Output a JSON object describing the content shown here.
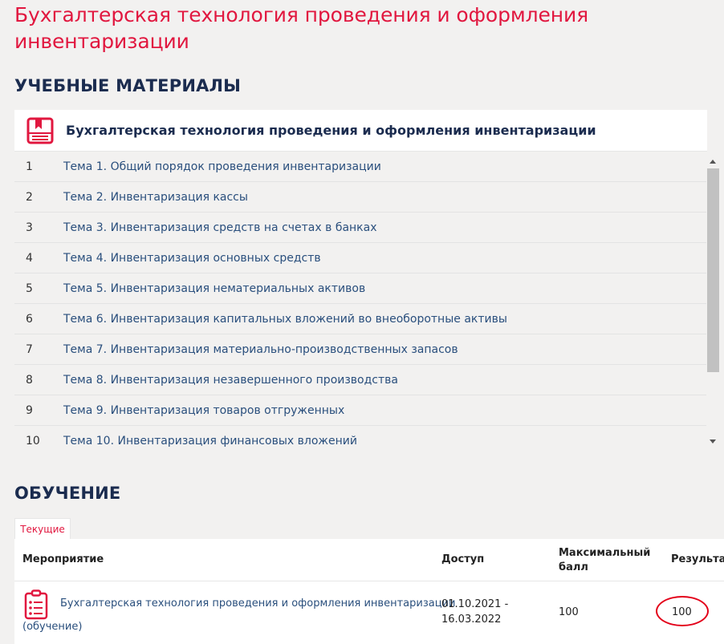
{
  "page": {
    "title": "Бухгалтерская технология проведения и оформления инвентаризации"
  },
  "materials": {
    "section_title": "УЧЕБНЫЕ МАТЕРИАЛЫ",
    "course_name": "Бухгалтерская технология проведения и оформления инвентаризации",
    "icon": "book-icon",
    "topics": [
      {
        "num": "1",
        "title": "Тема 1. Общий порядок проведения инвентаризации"
      },
      {
        "num": "2",
        "title": "Тема 2. Инвентаризация кассы"
      },
      {
        "num": "3",
        "title": "Тема 3. Инвентаризация средств на счетах в банках"
      },
      {
        "num": "4",
        "title": "Тема 4. Инвентаризация основных средств"
      },
      {
        "num": "5",
        "title": "Тема 5. Инвентаризация нематериальных активов"
      },
      {
        "num": "6",
        "title": "Тема 6. Инвентаризация капитальных вложений во внеоборотные активы"
      },
      {
        "num": "7",
        "title": "Тема 7. Инвентаризация материально-производственных запасов"
      },
      {
        "num": "8",
        "title": "Тема 8. Инвентаризация незавершенного производства"
      },
      {
        "num": "9",
        "title": "Тема 9. Инвентаризация товаров отгруженных"
      },
      {
        "num": "10",
        "title": "Тема 10. Инвентаризация финансовых вложений"
      }
    ]
  },
  "training": {
    "section_title": "ОБУЧЕНИЕ",
    "tab_label": "Текущие",
    "columns": {
      "event": "Мероприятие",
      "access": "Доступ",
      "max_score_line1": "Максимальный",
      "max_score_line2": "балл",
      "result": "Результат"
    },
    "rows": [
      {
        "icon": "clipboard-icon",
        "event_title": "Бухгалтерская технология проведения и оформления инвентаризации",
        "event_type": "(обучение)",
        "access_from": "01.10.2021 -",
        "access_to": "16.03.2022",
        "max_score": "100",
        "result": "100"
      }
    ]
  },
  "colors": {
    "title_red": "#e1173f",
    "heading_navy": "#1b2c4f",
    "link_blue": "#2a4f7d",
    "highlight_circle": "#e30019",
    "background": "#f2f1f0"
  }
}
